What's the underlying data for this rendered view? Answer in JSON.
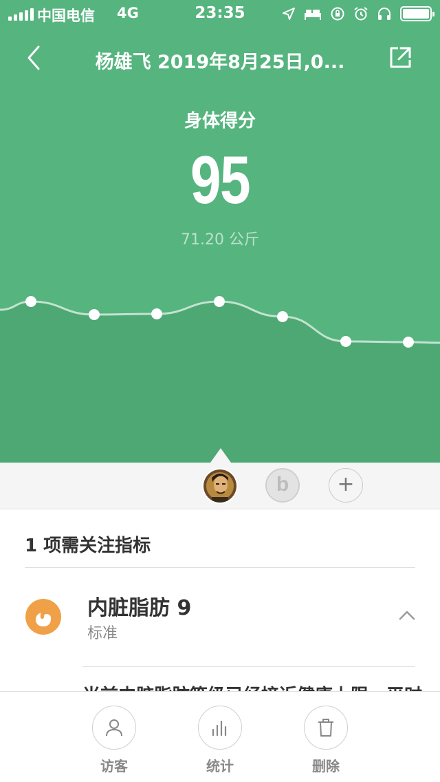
{
  "status_bar": {
    "carrier": "中国电信",
    "network": "4G",
    "time": "23:35",
    "icons": [
      "location-arrow-icon",
      "bed-icon",
      "rotation-lock-icon",
      "alarm-icon",
      "headphones-icon",
      "battery-icon"
    ]
  },
  "header": {
    "title": "杨雄飞 2019年8月25日,0...",
    "back_icon": "chevron-left-icon",
    "share_icon": "share-external-icon"
  },
  "score": {
    "label": "身体得分",
    "value": "95",
    "weight": "71.20 公斤"
  },
  "colors": {
    "hero_green": "#56b47f",
    "chart_fill": "#4ea874",
    "metric_orange": "#f0a147"
  },
  "chart_data": {
    "type": "area",
    "values": [
      0.58,
      0.77,
      0.76,
      0.58,
      0.8,
      1.16,
      1.17
    ],
    "note_axis": "",
    "grid": false
  },
  "users": {
    "second_user_letter": "b",
    "add_symbol": "+"
  },
  "attention": {
    "title": "1 项需关注指标",
    "metric_name": "内脏脂肪 9",
    "metric_status": "标准",
    "advice": "当前内脏脂肪等级已经接近健康上限，平时"
  },
  "bottom_bar": {
    "tabs": [
      {
        "label": "访客",
        "icon": "person-icon"
      },
      {
        "label": "统计",
        "icon": "bar-chart-icon"
      },
      {
        "label": "删除",
        "icon": "trash-icon"
      }
    ]
  }
}
